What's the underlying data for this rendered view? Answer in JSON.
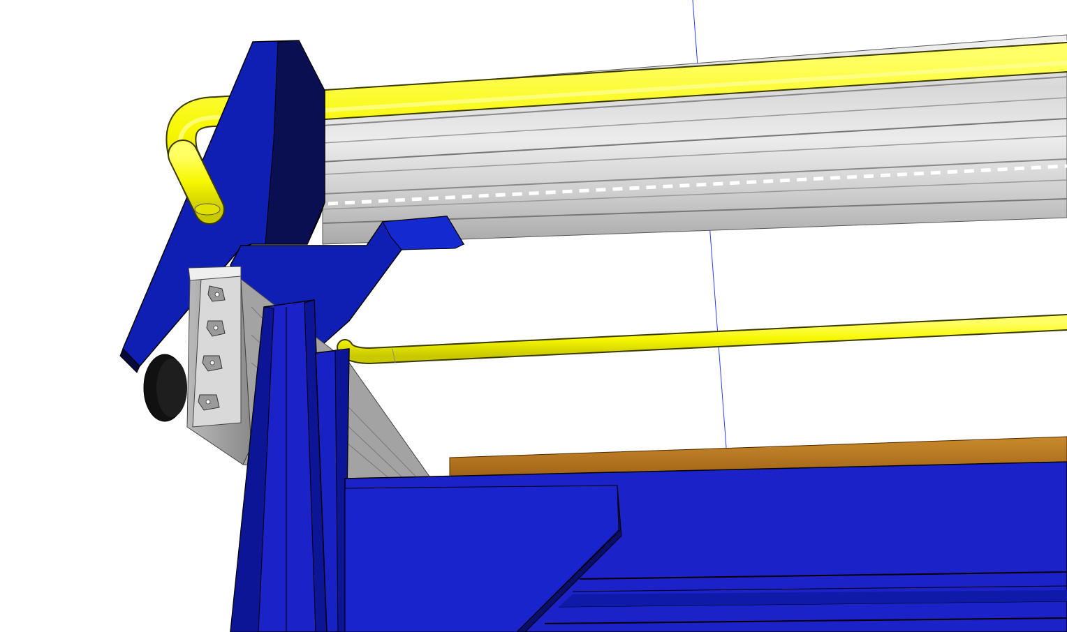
{
  "scene": {
    "colors": {
      "background": "#ffffff",
      "bracket_blue": "#0f1fb4",
      "bracket_dark": "#0a0f52",
      "frame_blue": "#1a22c8",
      "rail_light": "#e6e6e6",
      "rail_mid": "#bdbdbd",
      "rail_dark": "#7a7a7a",
      "tube_yellow": "#fbff22",
      "tube_shade": "#c7c800",
      "wood": "#b8761f",
      "axis_line": "#2a3cff",
      "knob": "#111111"
    },
    "icons": [
      "orbit-view-icon"
    ]
  }
}
